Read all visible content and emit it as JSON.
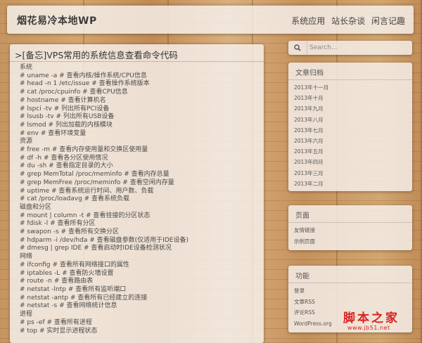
{
  "site": {
    "title": "烟花易冷本地WP"
  },
  "nav": {
    "items": [
      "系统应用",
      "站长杂谈",
      "闲言记趣"
    ]
  },
  "post": {
    "title": ">[备忘]VPS常用的系统信息查看命令代码",
    "lines": [
      "系统",
      "# uname -a # 查看内核/操作系统/CPU信息",
      "# head -n 1 /etc/issue # 查看操作系统版本",
      "# cat /proc/cpuinfo # 查看CPU信息",
      "# hostname # 查看计算机名",
      "# lspci -tv # 列出所有PCI设备",
      "# lsusb -tv # 列出所有USB设备",
      "# lsmod # 列出加载的内核模块",
      "# env # 查看环境变量",
      "资源",
      "# free -m # 查看内存使用量和交换区使用量",
      "# df -h # 查看各分区使用情况",
      "# du -sh # 查看指定目录的大小",
      "# grep MemTotal /proc/meminfo # 查看内存总量",
      "# grep MemFree /proc/meminfo # 查看空闲内存量",
      "# uptime # 查看系统运行时间、用户数、负载",
      "# cat /proc/loadavg # 查看系统负载",
      "磁盘和分区",
      "# mount | column -t # 查看挂接的分区状态",
      "# fdisk -l # 查看所有分区",
      "# swapon -s # 查看所有交换分区",
      "# hdparm -i /dev/hda # 查看磁盘参数(仅适用于IDE设备)",
      "# dmesg | grep IDE # 查看启动时IDE设备检测状况",
      "网络",
      "# ifconfig # 查看所有网络接口的属性",
      "# iptables -L # 查看防火墙设置",
      "# route -n # 查看路由表",
      "# netstat -lntp # 查看所有监听端口",
      "# netstat -antp # 查看所有已经建立的连接",
      "# netstat -s # 查看网络统计信息",
      "进程",
      "# ps -ef # 查看所有进程",
      "# top # 实时显示进程状态"
    ]
  },
  "search": {
    "placeholder": "Search...",
    "icon": "search-icon"
  },
  "archive": {
    "title": "文章归档",
    "items": [
      "2013年十一月",
      "2013年十月",
      "2013年九月",
      "2013年八月",
      "2013年七月",
      "2013年六月",
      "2013年五月",
      "2013年四月",
      "2013年三月",
      "2013年二月"
    ]
  },
  "pages": {
    "title": "页面",
    "items": [
      "友情链接",
      "示例页面"
    ]
  },
  "meta": {
    "title": "功能",
    "items": [
      "登录",
      "文章RSS",
      "评论RSS",
      "WordPress.org"
    ]
  },
  "watermark": {
    "title": "脚本之家",
    "url": "www.jb51.net",
    "color": "#d92323"
  }
}
